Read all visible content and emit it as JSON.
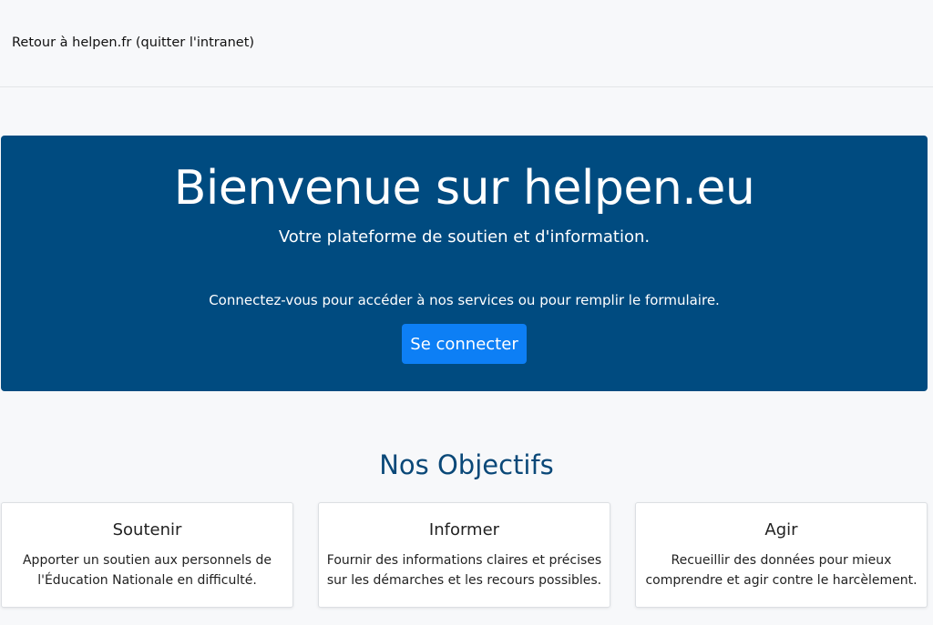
{
  "topbar": {
    "back_link": "Retour à helpen.fr (quitter l'intranet)"
  },
  "hero": {
    "title": "Bienvenue sur helpen.eu",
    "subtitle": "Votre plateforme de soutien et d'information.",
    "text": "Connectez-vous pour accéder à nos services ou pour remplir le formulaire.",
    "button_label": "Se connecter"
  },
  "objectives": {
    "title": "Nos Objectifs",
    "cards": [
      {
        "title": "Soutenir",
        "line1": "Apporter un soutien aux personnels de",
        "line2": "l'Éducation Nationale en difficulté."
      },
      {
        "title": "Informer",
        "line1": "Fournir des informations claires et précises",
        "line2": "sur les démarches et les recours possibles."
      },
      {
        "title": "Agir",
        "line1": "Recueillir des données pour mieux",
        "line2": "comprendre et agir contre le harcèlement."
      }
    ]
  },
  "colors": {
    "hero_background": "#004b80",
    "button": "#0d7ff5",
    "section_title": "#0a4878",
    "page_background": "#f7f8fa"
  }
}
